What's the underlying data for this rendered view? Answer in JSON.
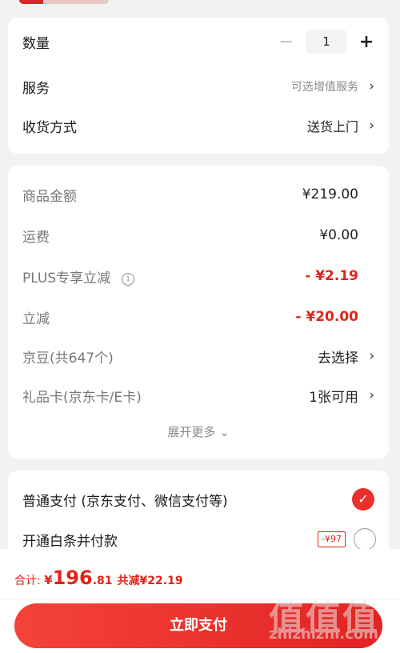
{
  "order": {
    "quantity_label": "数量",
    "quantity_value": "1",
    "minus_symbol": "−",
    "plus_symbol": "+",
    "service_label": "服务",
    "service_value": "可选增值服务",
    "delivery_label": "收货方式",
    "delivery_value": "送货上门",
    "chevron": "›"
  },
  "price_details": {
    "rows": [
      {
        "label": "商品金额",
        "value": "¥219.00"
      },
      {
        "label": "运费",
        "value": "¥0.00"
      },
      {
        "label": "PLUS专享立减",
        "value": "- ¥2.19"
      },
      {
        "label": "立减",
        "value": "- ¥20.00"
      },
      {
        "label": "京豆(共647个)",
        "value": "去选择"
      },
      {
        "label": "礼品卡(京东卡/E卡)",
        "value": "1张可用"
      }
    ],
    "info_icon_glyph": "i",
    "expand_more": "展开更多 ⌄"
  },
  "payment": {
    "option1_label": "普通支付 (京东支付、微信支付等)",
    "option1_check_glyph": "✓",
    "option2_label": "开通白条并付款",
    "option2_coupon": "-¥97"
  },
  "footer": {
    "total_label": "合计: ",
    "currency": "¥",
    "total_int": "196",
    "total_dec": ".81",
    "savings": "共减¥22.19",
    "pay_button": "立即支付"
  },
  "watermark": {
    "glyphs": "值值值",
    "site": "zhizhizhi.com"
  },
  "colors": {
    "accent_red": "#e2231a",
    "background": "#f2f2f2"
  }
}
